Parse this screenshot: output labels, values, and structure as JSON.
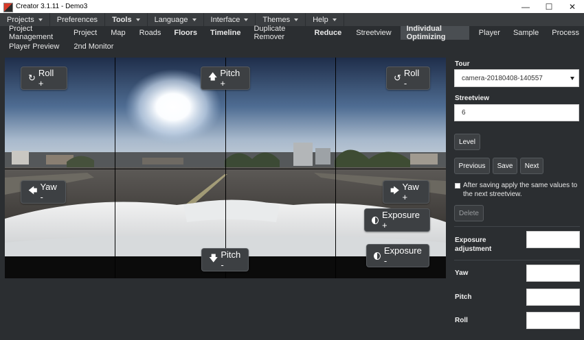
{
  "window": {
    "title": "Creator 3.1.11 - Demo3",
    "controls": [
      "—",
      "☐",
      "✕"
    ]
  },
  "menu": [
    {
      "label": "Projects",
      "bold": false
    },
    {
      "label": "Preferences",
      "bold": false
    },
    {
      "label": "Tools",
      "bold": true
    },
    {
      "label": "Language",
      "bold": false
    },
    {
      "label": "Interface",
      "bold": false
    },
    {
      "label": "Themes",
      "bold": false
    },
    {
      "label": "Help",
      "bold": false
    }
  ],
  "tabs": {
    "row1": [
      "Project Management",
      "Project",
      "Map",
      "Roads",
      "Floors",
      "Timeline",
      "Duplicate Remover",
      "Reduce",
      "Streetview",
      "Individual Optimizing",
      "Player",
      "Sample",
      "Process"
    ],
    "row2": [
      "Player Preview",
      "2nd Monitor"
    ],
    "active": "Individual Optimizing"
  },
  "viewer": {
    "roll_plus": "Roll +",
    "roll_minus": "Roll -",
    "pitch_plus": "Pitch +",
    "pitch_minus": "Pitch -",
    "yaw_minus": "Yaw -",
    "yaw_plus": "Yaw +",
    "exposure_plus": "Exposure +",
    "exposure_minus": "Exposure -"
  },
  "panel": {
    "tour_label": "Tour",
    "tour_value": "camera-20180408-140557",
    "streetview_label": "Streetview",
    "streetview_value": "6",
    "level_button": "Level",
    "previous_button": "Previous",
    "save_button": "Save",
    "next_button": "Next",
    "apply_checkbox_label": "After saving apply the same values to the next streetview.",
    "apply_checked": false,
    "delete_button": "Delete",
    "exposure_label": "Exposure adjustment",
    "exposure_value": "",
    "yaw_label": "Yaw",
    "yaw_value": "",
    "pitch_label": "Pitch",
    "pitch_value": "",
    "roll_label": "Roll",
    "roll_value": ""
  },
  "colors": {
    "background": "#2b2e31",
    "menubar": "#3a3d40",
    "active_tab": "#4a4e52",
    "button": "#3d4043"
  }
}
